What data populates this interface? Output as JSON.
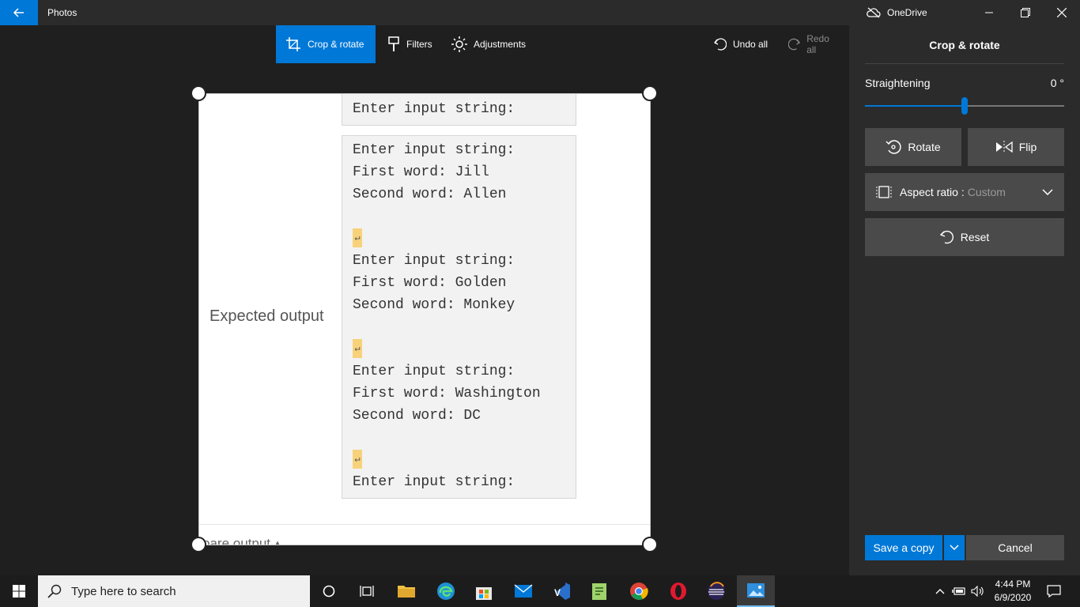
{
  "titlebar": {
    "app_title": "Photos",
    "onedrive_label": "OneDrive"
  },
  "toolbar": {
    "crop_rotate": "Crop & rotate",
    "filters": "Filters",
    "adjustments": "Adjustments",
    "undo_all": "Undo all",
    "redo_all": "Redo all"
  },
  "photo": {
    "expected_label": "Expected output",
    "top_line": "Enter input string:",
    "block_lines": [
      "Enter input string:",
      "First word: Jill",
      "Second word: Allen",
      "",
      "↵",
      "Enter input string:",
      "First word: Golden",
      "Second word: Monkey",
      "",
      "↵",
      "Enter input string:",
      "First word: Washington",
      "Second word: DC",
      "",
      "↵",
      "Enter input string:"
    ],
    "compare_text": "pare output ▴"
  },
  "panel": {
    "title": "Crop & rotate",
    "straightening_label": "Straightening",
    "straightening_value": "0 °",
    "straightening_level": 0.5,
    "rotate": "Rotate",
    "flip": "Flip",
    "aspect_label": "Aspect ratio :",
    "aspect_value": "Custom",
    "reset": "Reset",
    "save_copy": "Save a copy",
    "cancel": "Cancel"
  },
  "taskbar": {
    "search_placeholder": "Type here to search",
    "time": "4:44 PM",
    "date": "6/9/2020"
  },
  "colors": {
    "accent": "#0078d7",
    "panel_bg": "#2b2b2b",
    "button_bg": "#4a4a4a"
  }
}
